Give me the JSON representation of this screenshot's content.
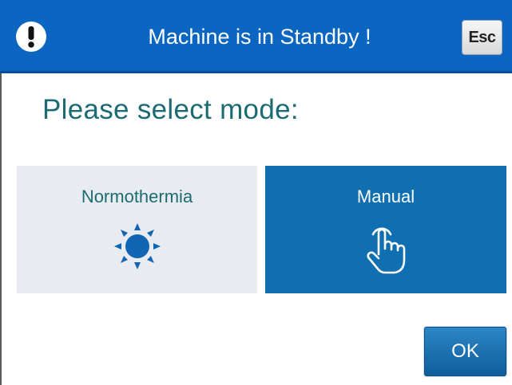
{
  "header": {
    "title": "Machine is in Standby !",
    "alert_icon": "exclamation-icon",
    "esc_label": "Esc",
    "background_color": "#0a66c0"
  },
  "prompt": {
    "text": "Please select mode:"
  },
  "modes": [
    {
      "label": "Normothermia",
      "icon": "sun-icon",
      "selected": false,
      "color": "#e8ecf0"
    },
    {
      "label": "Manual",
      "icon": "hand-pointer-icon",
      "selected": true,
      "color": "#0f6fb0"
    }
  ],
  "footer": {
    "ok_label": "OK"
  }
}
